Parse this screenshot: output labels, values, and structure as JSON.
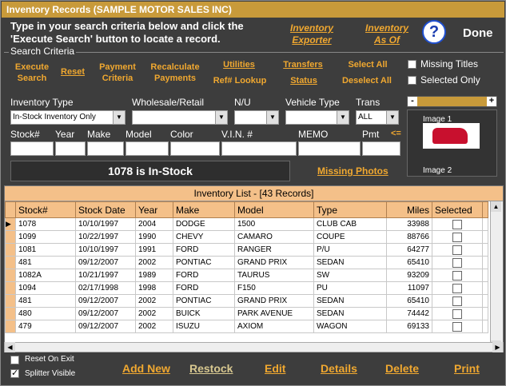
{
  "window": {
    "title": "Inventory Records  (SAMPLE MOTOR SALES INC)"
  },
  "header": {
    "instructions": "Type in your search criteria below and click the 'Execute Search' button to locate a record.",
    "exporter": "Inventory Exporter",
    "as_of": "Inventory As Of",
    "help_icon": "?",
    "done": "Done"
  },
  "criteria": {
    "group_label": "Search Criteria",
    "buttons": {
      "execute": "Execute Search",
      "reset": "Reset",
      "payment": "Payment Criteria",
      "recalc": "Recalculate Payments",
      "utilities": "Utilities",
      "refnum": "Ref# Lookup",
      "transfers": "Transfers",
      "status": "Status",
      "select_all": "Select All",
      "deselect_all": "Deselect All"
    },
    "checks": {
      "missing_titles": "Missing Titles",
      "selected_only": "Selected Only"
    },
    "labels": {
      "inventory_type": "Inventory Type",
      "wholesale": "Wholesale/Retail",
      "nu": "N/U",
      "vehicle_type": "Vehicle Type",
      "trans": "Trans",
      "stock": "Stock#",
      "year": "Year",
      "make": "Make",
      "model": "Model",
      "color": "Color",
      "vin": "V.I.N. #",
      "memo": "MEMO",
      "pmt": "Pmt",
      "pmt_arrow": "<="
    },
    "values": {
      "inventory_type": "In-Stock Inventory Only",
      "trans": "ALL"
    }
  },
  "status_text": "1078 is In-Stock",
  "missing_photos": "Missing Photos",
  "images": {
    "image1": "Image 1",
    "image2": "Image 2",
    "minus": "-",
    "plus": "+"
  },
  "grid": {
    "title": "Inventory List - [43 Records]",
    "columns": [
      "Stock#",
      "Stock Date",
      "Year",
      "Make",
      "Model",
      "Type",
      "Miles",
      "Selected"
    ],
    "rows": [
      [
        "1078",
        "10/10/1997",
        "2004",
        "DODGE",
        "1500",
        "CLUB CAB",
        "33988"
      ],
      [
        "1099",
        "10/22/1997",
        "1990",
        "CHEVY",
        "CAMARO",
        "COUPE",
        "88766"
      ],
      [
        "1081",
        "10/10/1997",
        "1991",
        "FORD",
        "RANGER",
        "P/U",
        "64277"
      ],
      [
        "481",
        "09/12/2007",
        "2002",
        "PONTIAC",
        "GRAND PRIX",
        "SEDAN",
        "65410"
      ],
      [
        "1082A",
        "10/21/1997",
        "1989",
        "FORD",
        "TAURUS",
        "SW",
        "93209"
      ],
      [
        "1094",
        "02/17/1998",
        "1998",
        "FORD",
        "F150",
        "PU",
        "11097"
      ],
      [
        "481",
        "09/12/2007",
        "2002",
        "PONTIAC",
        "GRAND PRIX",
        "SEDAN",
        "65410"
      ],
      [
        "480",
        "09/12/2007",
        "2002",
        "BUICK",
        "PARK AVENUE",
        "SEDAN",
        "74442"
      ],
      [
        "479",
        "09/12/2007",
        "2002",
        "ISUZU",
        "AXIOM",
        "WAGON",
        "69133"
      ]
    ]
  },
  "footer": {
    "reset_on_exit": "Reset On Exit",
    "splitter_visible": "Splitter Visible",
    "add_new": "Add New",
    "restock": "Restock",
    "edit": "Edit",
    "details": "Details",
    "delete": "Delete",
    "print": "Print"
  },
  "colors": {
    "accent": "#f0a830",
    "title_bar": "#c89a3a",
    "grid_header": "#f4c089",
    "restock": "#d8c890"
  }
}
